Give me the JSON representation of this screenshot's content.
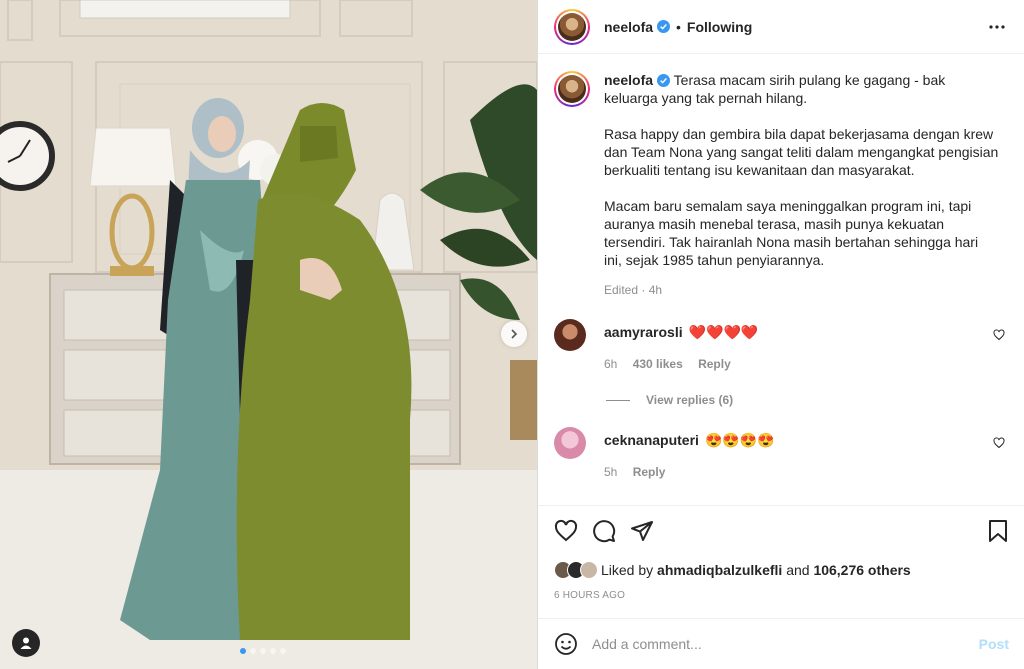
{
  "post": {
    "username": "neelofa",
    "verified": true,
    "follow_status": "Following",
    "bullet": "•",
    "carousel": {
      "slides": 5,
      "current": 1
    }
  },
  "caption": {
    "username": "neelofa",
    "paragraphs": [
      "Terasa macam sirih pulang ke gagang - bak keluarga yang tak pernah hilang.",
      "Rasa happy dan gembira bila dapat bekerjasama dengan krew dan Team Nona yang sangat teliti dalam mengangkat pengisian berkualiti tentang isu kewanitaan dan masyarakat.",
      "Macam baru semalam saya meninggalkan program ini, tapi auranya masih menebal terasa, masih punya kekuatan tersendiri. Tak hairanlah Nona masih bertahan sehingga hari ini, sejak 1985 tahun penyiarannya."
    ],
    "meta": "Edited · 4h"
  },
  "comments": [
    {
      "username": "aamyrarosli",
      "text": "❤️❤️❤️❤️",
      "time": "6h",
      "likes": "430 likes",
      "reply": "Reply",
      "view_replies": "View replies (6)"
    },
    {
      "username": "ceknanaputeri",
      "text": "😍😍😍😍",
      "time": "5h",
      "reply": "Reply"
    }
  ],
  "actions": {
    "liked_by_prefix": "Liked by",
    "liked_by_user": "ahmadiqbalzulkefli",
    "and": "and",
    "others": "106,276 others",
    "timestamp": "6 HOURS AGO"
  },
  "add_comment": {
    "placeholder": "Add a comment...",
    "post_label": "Post"
  },
  "colors": {
    "accent": "#0095f6",
    "post_disabled": "#b2dffc",
    "verified": "#3897f0",
    "heart_red": "#ed4956"
  },
  "icons": [
    "verified-badge-icon",
    "more-options-icon",
    "heart-icon",
    "comment-icon",
    "share-icon",
    "bookmark-icon",
    "emoji-icon",
    "next-arrow-icon",
    "user-tag-icon"
  ]
}
